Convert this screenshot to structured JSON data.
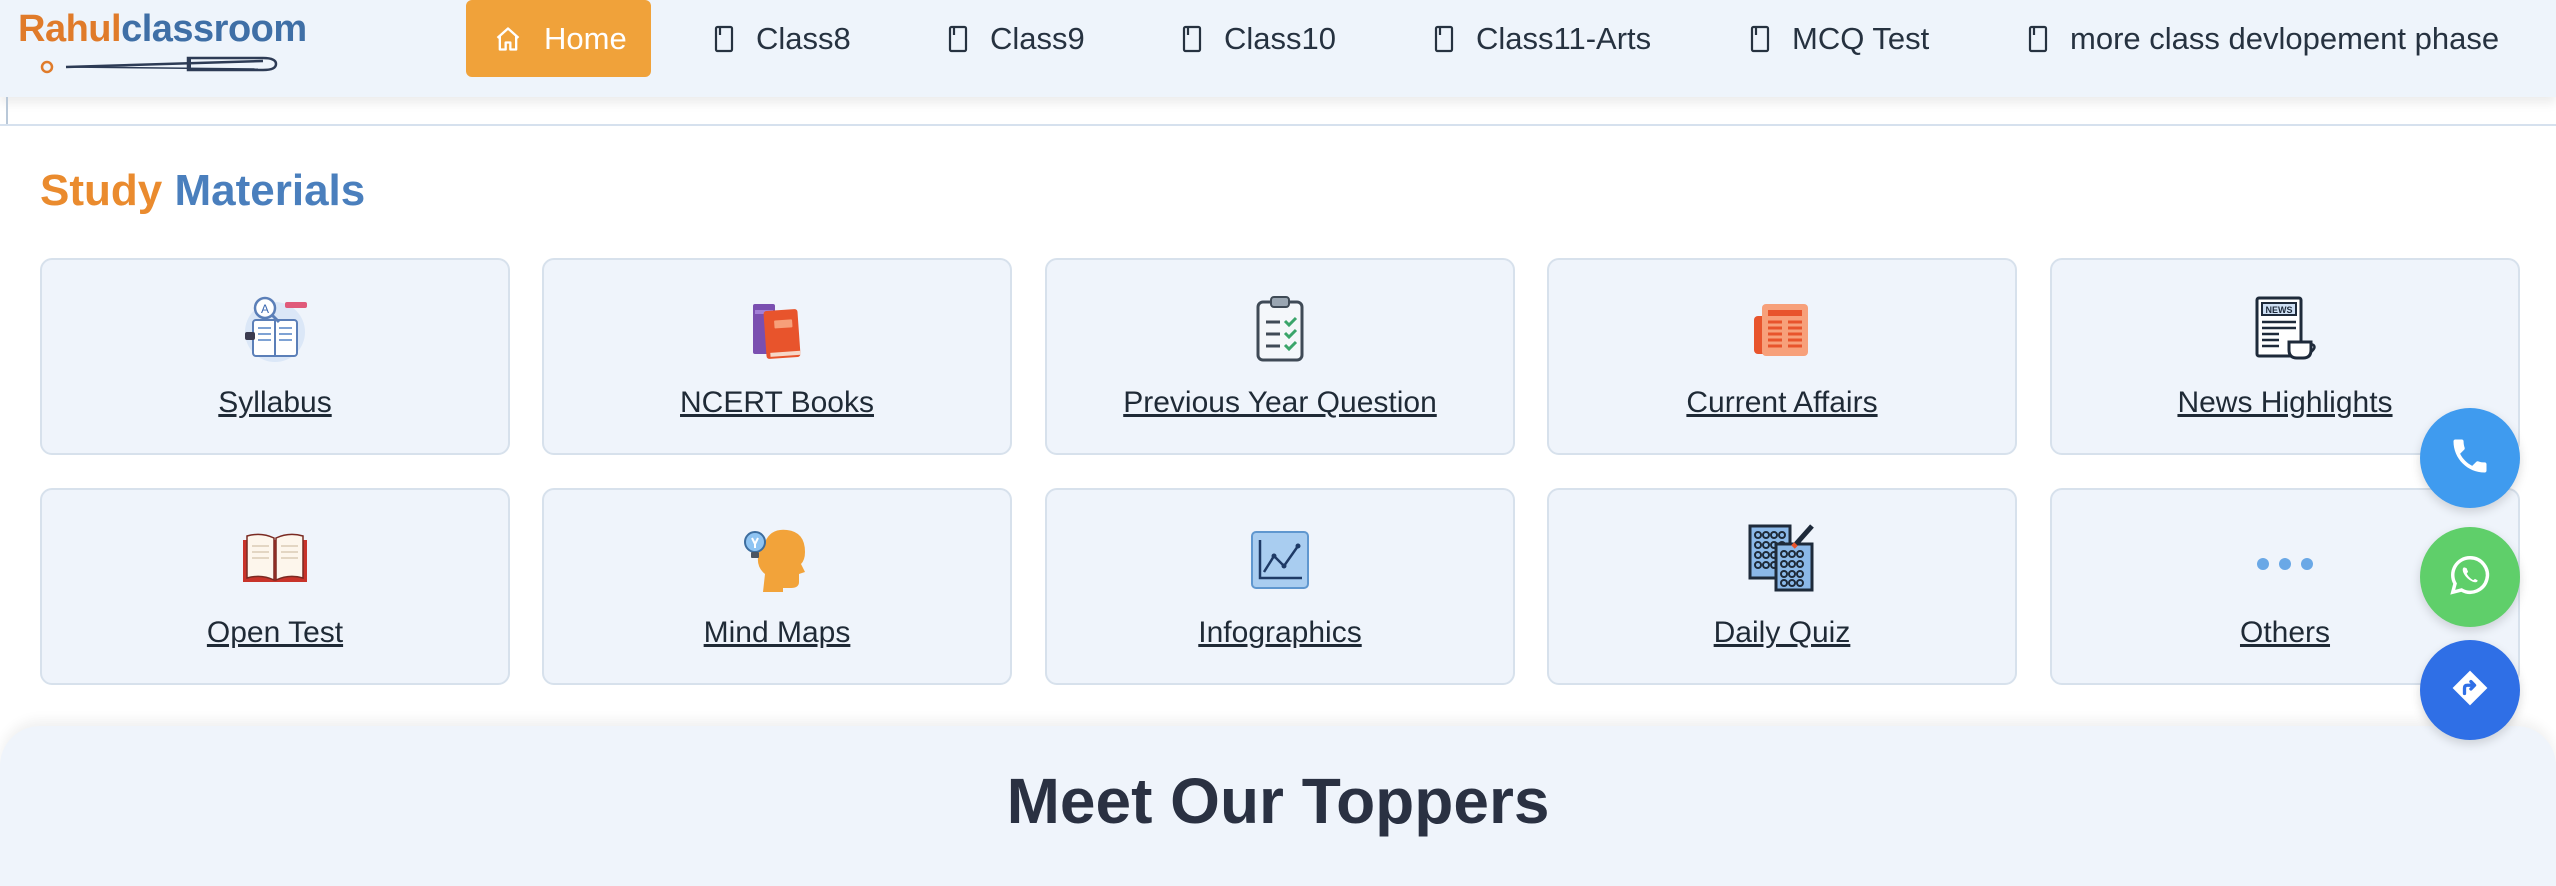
{
  "logo": {
    "part1": "Rahul",
    "part2": "classroom"
  },
  "nav": {
    "home": "Home",
    "items": [
      "Class8",
      "Class9",
      "Class10",
      "Class11-Arts",
      "MCQ Test",
      "more class devlopement phase"
    ]
  },
  "study": {
    "title_part1": "Study",
    "title_part2": "Materials",
    "cards": [
      {
        "label": "Syllabus",
        "icon": "syllabus-icon"
      },
      {
        "label": "NCERT Books",
        "icon": "books-icon"
      },
      {
        "label": "Previous Year Question",
        "icon": "clipboard-checklist-icon"
      },
      {
        "label": "Current Affairs",
        "icon": "newspaper-icon"
      },
      {
        "label": "News Highlights",
        "icon": "news-coffee-icon"
      },
      {
        "label": "Open Test",
        "icon": "open-book-icon"
      },
      {
        "label": "Mind Maps",
        "icon": "head-bulb-icon"
      },
      {
        "label": "Infographics",
        "icon": "line-chart-icon"
      },
      {
        "label": "Daily Quiz",
        "icon": "answer-sheet-icon"
      },
      {
        "label": "Others",
        "icon": "ellipsis-icon"
      }
    ]
  },
  "toppers": {
    "title": "Meet Our Toppers"
  },
  "fabs": [
    {
      "name": "phone",
      "icon": "phone-icon",
      "color": "#3f9bef"
    },
    {
      "name": "whatsapp",
      "icon": "whatsapp-icon",
      "color": "#5fcf6a"
    },
    {
      "name": "directions",
      "icon": "directions-icon",
      "color": "#2f6fe6"
    }
  ],
  "colors": {
    "accent_orange": "#f0a23a",
    "brand_blue": "#4a7fbd",
    "card_bg": "#eff4fb"
  }
}
